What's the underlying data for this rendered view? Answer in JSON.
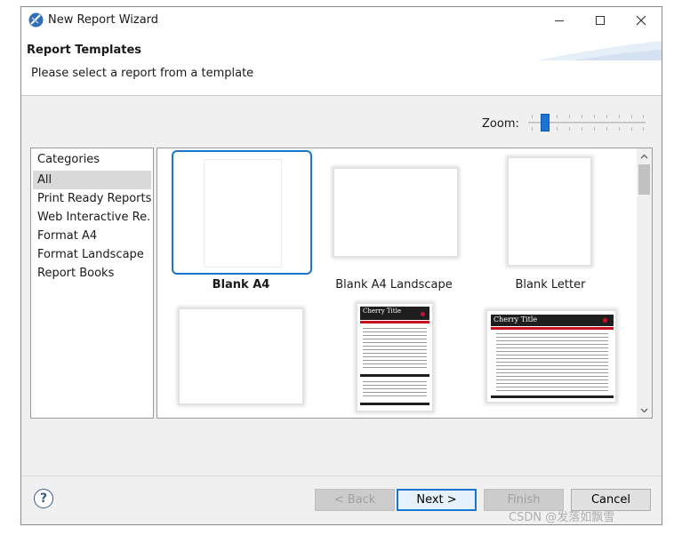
{
  "window": {
    "title": "New Report Wizard"
  },
  "header": {
    "title": "Report Templates",
    "description": "Please select a report from a template"
  },
  "zoom": {
    "label": "Zoom:",
    "level": 0.12
  },
  "categories": {
    "heading": "Categories",
    "items": [
      {
        "label": "All",
        "selected": true
      },
      {
        "label": "Print Ready Reports",
        "selected": false
      },
      {
        "label": "Web Interactive Re...",
        "selected": false
      },
      {
        "label": "Format A4",
        "selected": false
      },
      {
        "label": "Format Landscape",
        "selected": false
      },
      {
        "label": "Report Books",
        "selected": false
      }
    ]
  },
  "templates": {
    "items": [
      {
        "label": "Blank A4",
        "selected": true
      },
      {
        "label": "Blank A4 Landscape",
        "selected": false
      },
      {
        "label": "Blank Letter",
        "selected": false
      },
      {
        "label": "",
        "selected": false
      },
      {
        "label": "",
        "selected": false,
        "thumb_title": "Cherry Title"
      },
      {
        "label": "",
        "selected": false,
        "thumb_title": "Cherry Title"
      }
    ]
  },
  "buttons": {
    "help": "?",
    "back": "< Back",
    "next": "Next >",
    "finish": "Finish",
    "cancel": "Cancel"
  },
  "watermark": "CSDN @发落如飘雪",
  "colors": {
    "accent": "#1c75cc",
    "slider_thumb": "#1b73d6",
    "thumb_red": "#c8101e"
  }
}
